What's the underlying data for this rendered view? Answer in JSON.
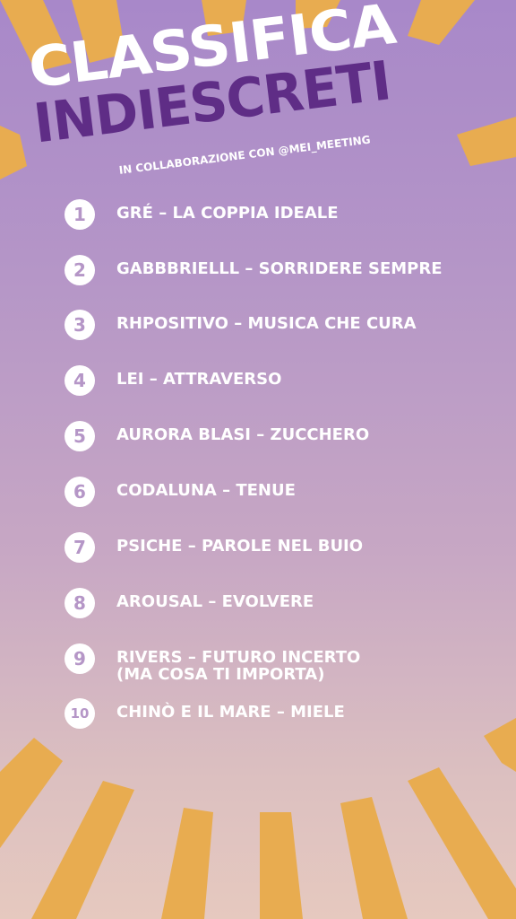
{
  "header": {
    "title_line1": "CLASSIFICA",
    "title_line2": "INDIESCRETI",
    "subtitle": "IN COLLABORAZIONE CON @MEI_MEETING"
  },
  "ranking": [
    {
      "rank": "1",
      "line1": "GRÉ – LA COPPIA IDEALE",
      "line2": ""
    },
    {
      "rank": "2",
      "line1": "GABBBRIELLL – SORRIDERE SEMPRE",
      "line2": ""
    },
    {
      "rank": "3",
      "line1": "RHPOSITIVO – MUSICA CHE CURA",
      "line2": ""
    },
    {
      "rank": "4",
      "line1": "LEI – ATTRAVERSO",
      "line2": ""
    },
    {
      "rank": "5",
      "line1": "AURORA BLASI – ZUCCHERO",
      "line2": ""
    },
    {
      "rank": "6",
      "line1": "CODALUNA – TENUE",
      "line2": ""
    },
    {
      "rank": "7",
      "line1": "PSICHE – PAROLE NEL BUIO",
      "line2": ""
    },
    {
      "rank": "8",
      "line1": "AROUSAL – EVOLVERE",
      "line2": ""
    },
    {
      "rank": "9",
      "line1": "RIVERS – FUTURO INCERTO",
      "line2": "(MA COSA TI IMPORTA)"
    },
    {
      "rank": "10",
      "line1": "CHINÒ E IL MARE – MIELE",
      "line2": ""
    }
  ],
  "colors": {
    "ray": "#e8ac50",
    "title_primary": "#ffffff",
    "title_secondary": "#5f2d86",
    "number_text": "#b596c7"
  }
}
